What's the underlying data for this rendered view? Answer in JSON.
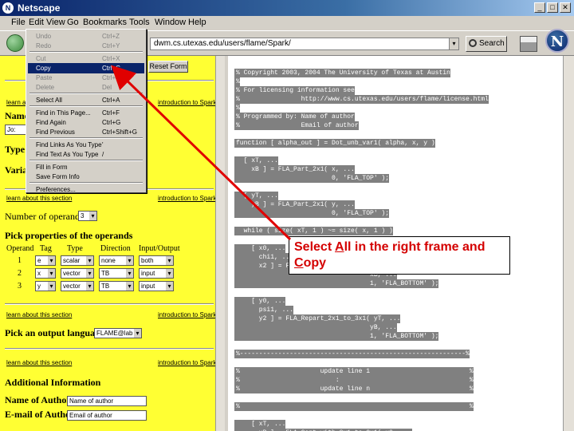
{
  "window": {
    "title": "Netscape",
    "buttons": [
      "_",
      "□",
      "✕"
    ]
  },
  "menubar": [
    "File",
    "Edit",
    "View",
    "Go",
    "Bookmarks",
    "Tools",
    "Window",
    "Help"
  ],
  "navbar": {
    "url": "dwm.cs.utexas.edu/users/flame/Spark/",
    "search_label": "Search",
    "logo_letter": "N"
  },
  "edit_menu": {
    "items": [
      {
        "label": "Undo",
        "shortcut": "Ctrl+Z",
        "state": "disabled"
      },
      {
        "label": "Redo",
        "shortcut": "Ctrl+Y",
        "state": "disabled"
      },
      {
        "label": "Cut",
        "shortcut": "Ctrl+X",
        "state": "disabled"
      },
      {
        "label": "Copy",
        "shortcut": "Ctrl+C",
        "state": "highlighted"
      },
      {
        "label": "Paste",
        "shortcut": "Ctrl+V",
        "state": "disabled"
      },
      {
        "label": "Delete",
        "shortcut": "Del",
        "state": "disabled"
      },
      {
        "label": "Select All",
        "shortcut": "Ctrl+A",
        "state": "enabled"
      },
      {
        "label": "Find in This Page...",
        "shortcut": "Ctrl+F",
        "state": "enabled"
      },
      {
        "label": "Find Again",
        "shortcut": "Ctrl+G",
        "state": "enabled"
      },
      {
        "label": "Find Previous",
        "shortcut": "Ctrl+Shift+G",
        "state": "enabled"
      },
      {
        "label": "Find Links As You Type",
        "shortcut": "'",
        "state": "enabled"
      },
      {
        "label": "Find Text As You Type",
        "shortcut": "/",
        "state": "enabled"
      },
      {
        "label": "Fill in Form",
        "shortcut": "",
        "state": "enabled"
      },
      {
        "label": "Save Form Info",
        "shortcut": "",
        "state": "enabled"
      },
      {
        "label": "Preferences...",
        "shortcut": "",
        "state": "enabled"
      }
    ]
  },
  "left_frame": {
    "reset_button": "Reset Form",
    "learn_link": "learn about this section",
    "intro_link": "introduction to Spark",
    "name_label": "Name",
    "name_value": "Jo:",
    "type_label": "Type",
    "variant_label": "Varia",
    "num_operands_label": "Number of operands",
    "num_operands_value": "3",
    "pick_props_label": "Pick properties of the operands",
    "table_headers": [
      "Operand",
      "Tag",
      "Type",
      "Direction",
      "Input/Output"
    ],
    "rows": [
      {
        "num": "1",
        "tag": "e",
        "type": "scalar",
        "direction": "none",
        "io": "both"
      },
      {
        "num": "2",
        "tag": "x",
        "type": "vector",
        "direction": "TB",
        "io": "input"
      },
      {
        "num": "3",
        "tag": "y",
        "type": "vector",
        "direction": "TB",
        "io": "input"
      }
    ],
    "output_lang_label": "Pick an output language:",
    "output_lang_value": "FLAME@lab",
    "additional_info_label": "Additional Information",
    "author_name_label": "Name of Author",
    "author_name_value": "Name of author",
    "author_email_label": "E-mail of Author",
    "author_email_value": "Email of author"
  },
  "code_lines": [
    "% Copyright 2003, 2004 The University of Texas at Austin",
    "%",
    "% For licensing information see",
    "%                http://www.cs.utexas.edu/users/flame/license.html",
    "%",
    "% Programmed by: Name of author",
    "%                Email of author",
    "",
    "function [ alpha_out ] = Dot_unb_var1( alpha, x, y )",
    "",
    "  [ xT, ...",
    "    xB ] = FLA_Part_2x1( x, ...",
    "                         0, 'FLA_TOP' );",
    "",
    "  [ yT, ...",
    "    yB ] = FLA_Part_2x1( y, ...",
    "                         0, 'FLA_TOP' );",
    "",
    "  while ( size( xT, 1 ) ~= size( x, 1 ) )",
    "",
    "    [ x0, ...",
    "      chi1, ...",
    "      x2 ] = FLA_Repart_2x1_to_3x1( xT, ...",
    "                                   xB, ...",
    "                                   1, 'FLA_BOTTOM' );",
    "",
    "    [ y0, ...",
    "      psi1, ...",
    "      y2 ] = FLA_Repart_2x1_to_3x1( yT, ...",
    "                                   yB, ...",
    "                                   1, 'FLA_BOTTOM' );",
    "",
    "%-----------------------------------------------------------%",
    "",
    "%                     update line 1                          %",
    "%                         :                                  %",
    "%                     update line n                          %",
    "",
    "%                                                            %",
    "",
    "    [ xT, ...",
    "      xB ] = FLA_Cont_with_3x1_to_2x1( x0, ..."
  ],
  "callout": {
    "line1": "Select All in the right frame and",
    "line2": "Copy"
  },
  "colors": {
    "left_bg": "#ffff33",
    "highlight": "#0a246a",
    "callout_text": "#d40000",
    "arrow": "#e00000"
  }
}
